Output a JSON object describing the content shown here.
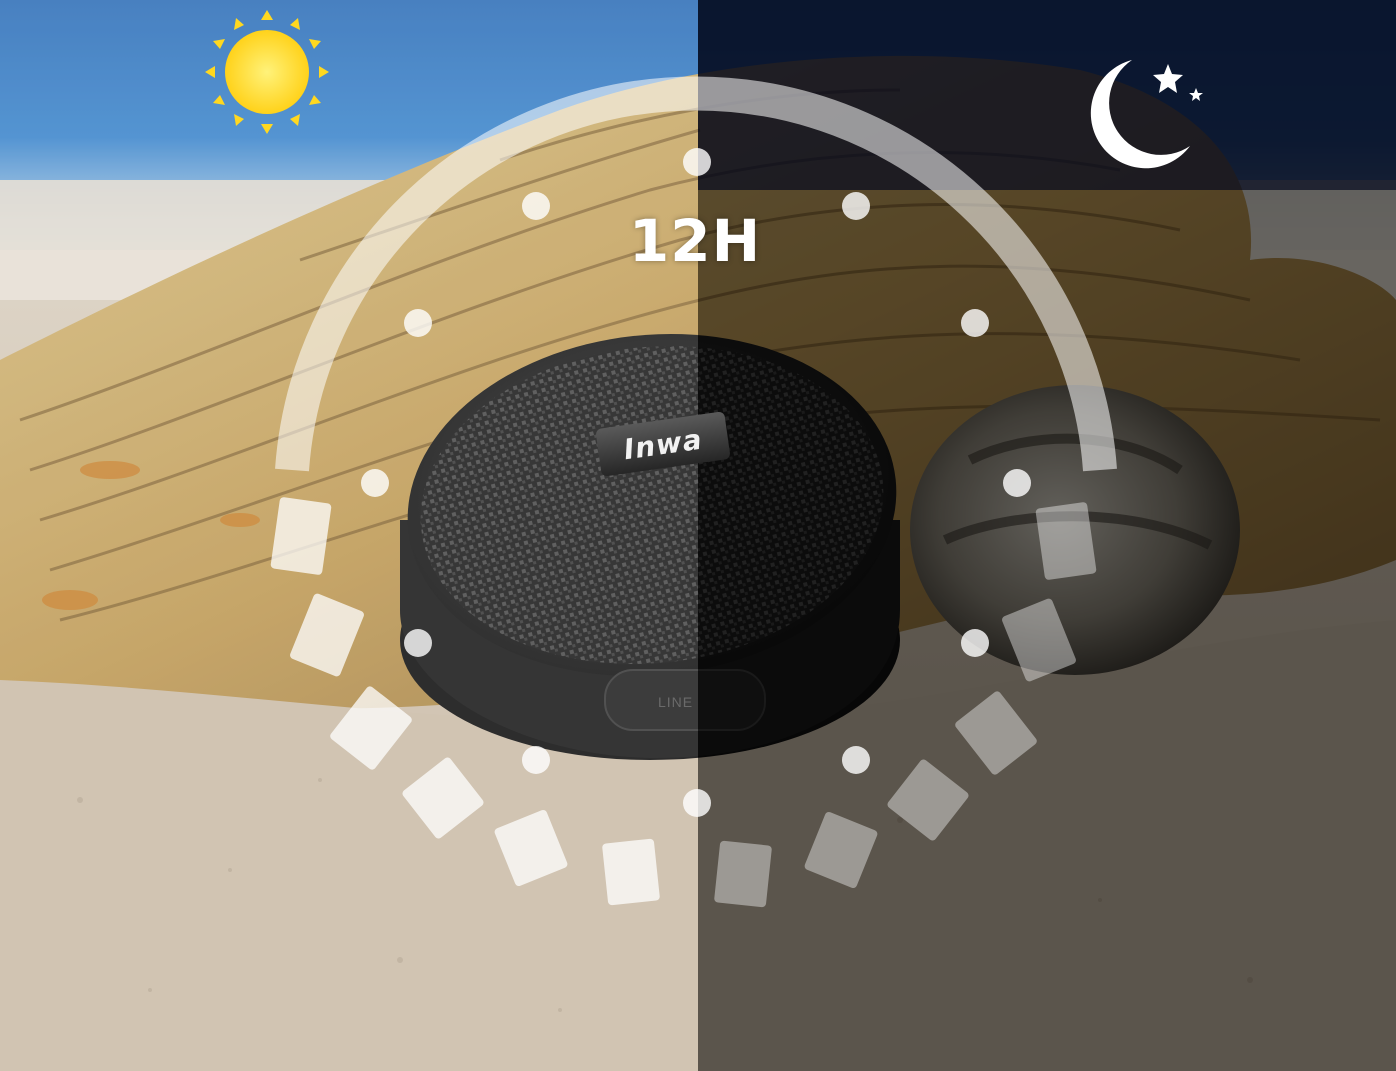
{
  "headline": "12H",
  "brand_logo": "Inwa",
  "port_label": "LINE",
  "icons": {
    "day": "sun-icon",
    "night": "moon-and-stars-icon"
  },
  "colors": {
    "sun": "#ffd820",
    "sky_day": "#2f6fb8",
    "sky_night": "#0a1230",
    "dial": "#ffffff"
  }
}
